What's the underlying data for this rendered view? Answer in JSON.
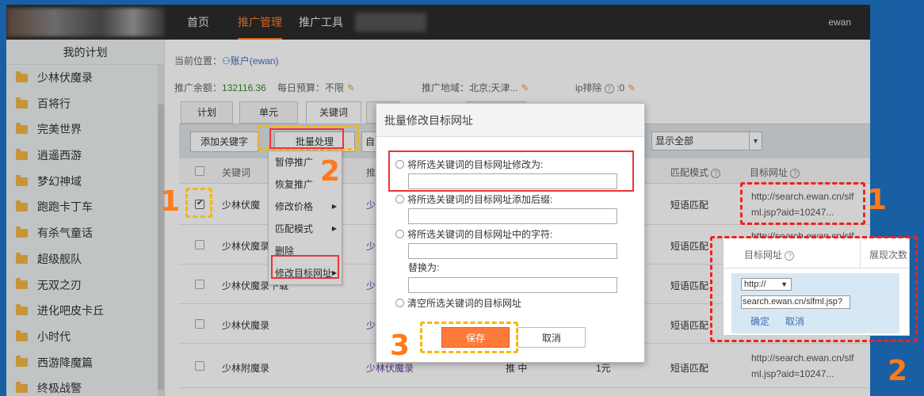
{
  "nav": {
    "items": [
      "首页",
      "推广管理",
      "推广工具"
    ],
    "active_index": 1,
    "user": "ewan"
  },
  "sidebar": {
    "title": "我的计划",
    "items": [
      "少林伏魔录",
      "百将行",
      "完美世界",
      "逍遥西游",
      "梦幻神域",
      "跑跑卡丁车",
      "有杀气童话",
      "超级舰队",
      "无双之刃",
      "进化吧皮卡丘",
      "小时代",
      "西游降魔篇",
      "终极战警"
    ]
  },
  "breadcrumb": {
    "prefix": "当前位置：",
    "link": "账户(ewan)"
  },
  "stats": {
    "balance_label": "推广余额：",
    "balance": "132116.36",
    "budget_label": "每日预算：",
    "budget": "不限",
    "region_label": "推广地域：",
    "region": "北京;天津...",
    "ip_label": "ip排除",
    "ip_value": ":0"
  },
  "tabs": [
    "计划",
    "单元",
    "关键词"
  ],
  "toolbar": {
    "add_keyword": "添加关键字",
    "batch": "批量处理",
    "custom_partial": "自定",
    "filter_value": "显示全部"
  },
  "table": {
    "headers": {
      "keyword": "关键词",
      "promo": "推",
      "match": "匹配模式",
      "target": "目标网址"
    },
    "rows": [
      {
        "keyword": "少林伏魔",
        "promo": "少林",
        "match": "短语匹配",
        "url": [
          "http://search.ewan.cn/slf",
          "ml.jsp?aid=10247..."
        ],
        "checked": true
      },
      {
        "keyword": "少林伏魔录手",
        "promo": "少林",
        "match": "短语匹配",
        "url": [
          "http://search.ewan.cn/slf",
          ""
        ],
        "checked": false
      },
      {
        "keyword": "少林伏魔录下载",
        "promo": "少林",
        "match": "短语匹配",
        "url": [
          "",
          ""
        ],
        "checked": false
      },
      {
        "keyword": "少林伏魔录",
        "promo": "少林",
        "match": "短语匹配",
        "url": [
          "",
          ""
        ],
        "checked": false
      },
      {
        "keyword": "少林附魔录",
        "promo": "少林伏魔录",
        "status": "推 中",
        "price": "1元",
        "match": "短语匹配",
        "url": [
          "http://search.ewan.cn/slf",
          "ml.jsp?aid=10247..."
        ],
        "checked": false
      }
    ]
  },
  "dropdown": [
    "暂停推广",
    "恢复推广",
    "修改价格",
    "匹配模式",
    "删除",
    "修改目标网址"
  ],
  "modal": {
    "title": "批量修改目标网址",
    "option1": "将所选关键词的目标网址修改为:",
    "option2": "将所选关键词的目标网址添加后缀:",
    "option3": "将所选关键词的目标网址中的字符:",
    "replace_label": "替换为:",
    "option4": "清空所选关键词的目标网址",
    "save": "保存",
    "cancel": "取消"
  },
  "zoom": {
    "header": "目标网址",
    "header2": "展现次数",
    "protocol": "http://",
    "url_value": "search.ewan.cn/slfml.jsp?",
    "confirm": "确定",
    "cancel": "取消"
  },
  "annotations": {
    "n1": "1",
    "n2": "2",
    "n3": "3"
  },
  "colors": {
    "accent": "#ff7a2a",
    "annotation_red": "#e22222",
    "annotation_yellow": "#f5b800"
  }
}
